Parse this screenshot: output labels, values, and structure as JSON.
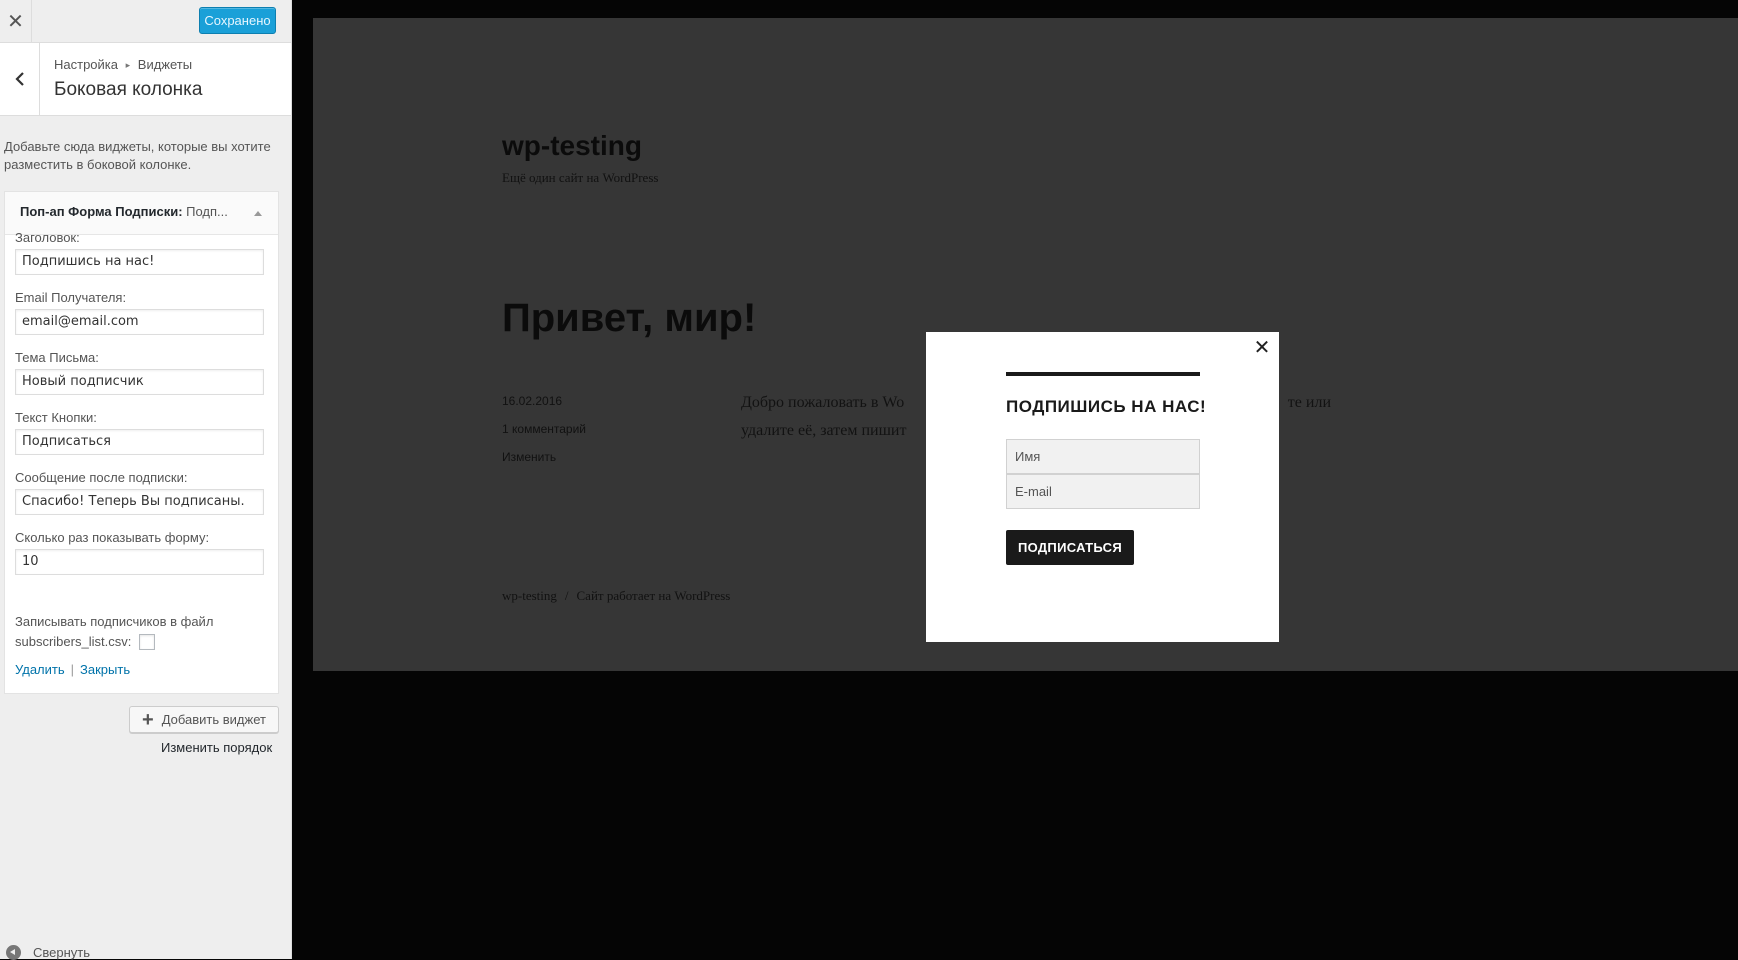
{
  "sidebar": {
    "close_symbol": "✕",
    "saved_label": "Сохранено",
    "breadcrumb": {
      "parent": "Настройка",
      "separator": "▸",
      "current": "Виджеты"
    },
    "section_title": "Боковая колонка",
    "description": "Добавьте сюда виджеты, которые вы хотите разместить в боковой колонке.",
    "widget": {
      "title_bold": "Поп-ап Форма Подписки:",
      "title_rest": " Подп...",
      "fields": [
        {
          "label": "Заголовок:",
          "value": "Подпишись на нас!"
        },
        {
          "label": "Email Получателя:",
          "value": "email@email.com"
        },
        {
          "label": "Тема Письма:",
          "value": "Новый подписчик"
        },
        {
          "label": "Текст Кнопки:",
          "value": "Подписаться"
        },
        {
          "label": "Сообщение после подписки:",
          "value": "Спасибо! Теперь Вы подписаны."
        },
        {
          "label": "Сколько раз показывать форму:",
          "value": "10"
        }
      ],
      "checkbox_label": "Записывать подписчиков в файл subscribers_list.csv:",
      "checkbox_checked": false,
      "delete_label": "Удалить",
      "action_sep": "|",
      "close_label": "Закрыть"
    },
    "add_widget_label": "Добавить виджет",
    "reorder_label": "Изменить порядок",
    "collapse_label": "Свернуть"
  },
  "preview": {
    "site_title": "wp-testing",
    "site_tagline": "Ещё один сайт на WordPress",
    "post_title": "Привет, мир!",
    "post_date": "16.02.2016",
    "post_comments": "1 комментарий",
    "post_edit": "Изменить",
    "post_body_line1": "Добро пожаловать в Wo",
    "post_body_line1_end": "те или",
    "post_body_line2": "удалите её, затем пишит",
    "footer_site": "wp-testing",
    "footer_sep": "/",
    "footer_powered": "Сайт работает на WordPress"
  },
  "modal": {
    "close_symbol": "✕",
    "title": "ПОДПИШИСЬ НА НАС!",
    "name_placeholder": "Имя",
    "email_placeholder": "E-mail",
    "submit_label": "ПОДПИСАТЬСЯ"
  },
  "colors": {
    "accent": "#1aa0d8",
    "link": "#0073aa",
    "preview_bg": "#363636",
    "overlay_bg": "#050505",
    "button_dark": "#1a1a1a"
  }
}
